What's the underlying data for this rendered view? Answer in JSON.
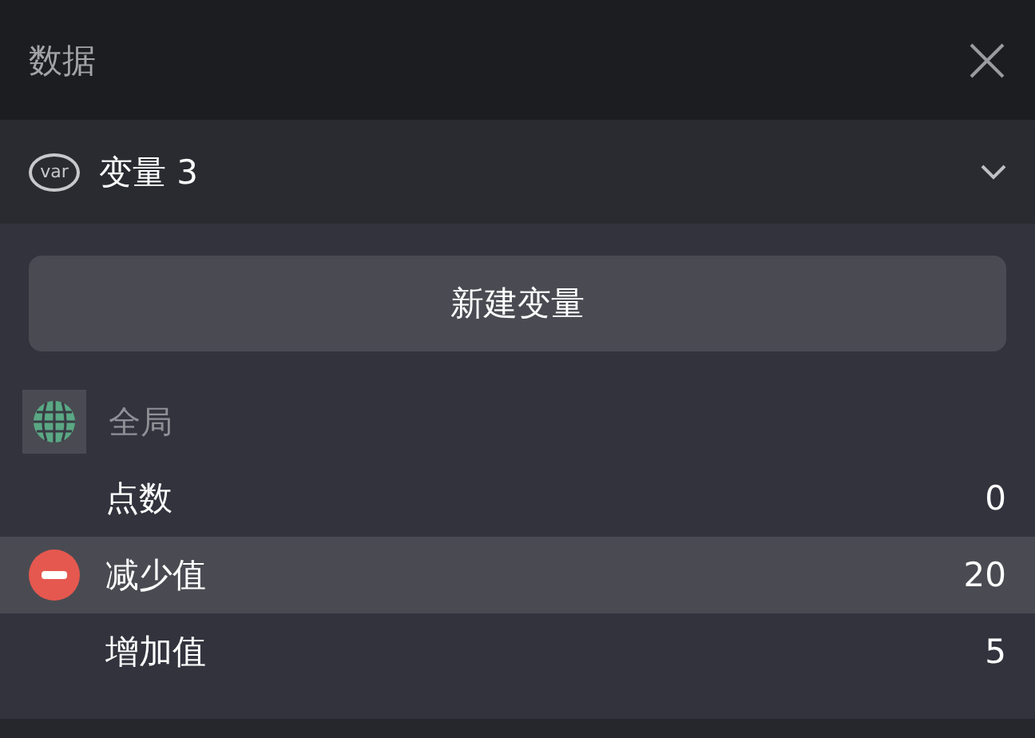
{
  "header": {
    "title": "数据"
  },
  "variable_picker": {
    "badge": "var",
    "value": "变量 3"
  },
  "new_variable_button": "新建变量",
  "group": {
    "label": "全局",
    "rows": [
      {
        "name": "点数",
        "value": "0",
        "selected": false
      },
      {
        "name": "减少值",
        "value": "20",
        "selected": true
      },
      {
        "name": "增加值",
        "value": "5",
        "selected": false
      }
    ]
  }
}
